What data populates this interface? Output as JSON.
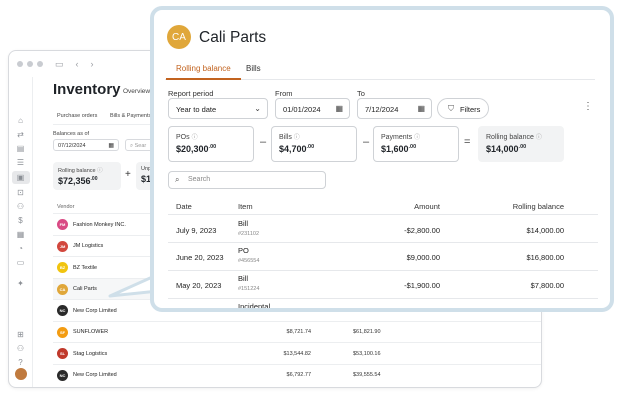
{
  "background_app": {
    "title": "Inventory",
    "overview_tab": "Overview",
    "subtabs": [
      "Purchase orders",
      "Bills & Payments"
    ],
    "balances_label": "Balances as of",
    "balances_date": "07/12/2024",
    "search_fragment": "Sear",
    "rolling_balance_label": "Rolling balance",
    "rolling_balance_value": "$72,356",
    "rolling_balance_cents": ".00",
    "plus": "+",
    "unpaid_label": "Unpa",
    "unpaid_value": "$13",
    "vendor_header": "Vendor",
    "vendors": [
      {
        "name": "Fashion Monkey INC.",
        "logo": "FM",
        "color": "#d94a84",
        "amt1": "",
        "amt2": ""
      },
      {
        "name": "JM Logistics",
        "logo": "JM",
        "color": "#d2473d",
        "amt1": "",
        "amt2": ""
      },
      {
        "name": "BZ Textile",
        "logo": "BZ",
        "color": "#f1c40f",
        "amt1": "",
        "amt2": ""
      },
      {
        "name": "Cali Parts",
        "logo": "CA",
        "color": "#e0a73a",
        "amt1": "",
        "amt2": ""
      },
      {
        "name": "New Corp Limited",
        "logo": "NC",
        "color": "#2a2a2a",
        "amt1": "",
        "amt2": ""
      },
      {
        "name": "SUNFLOWER",
        "logo": "SF",
        "color": "#f39c12",
        "amt1": "$8,721.74",
        "amt2": "$61,821.90"
      },
      {
        "name": "Stag Logistics",
        "logo": "SL",
        "color": "#c0392b",
        "amt1": "$13,544.82",
        "amt2": "$53,100.16"
      },
      {
        "name": "New Corp Limited",
        "logo": "NC",
        "color": "#2a2a2a",
        "amt1": "$6,792.77",
        "amt2": "$39,555.54"
      }
    ]
  },
  "panel": {
    "avatar_initials": "CA",
    "title": "Cali Parts",
    "tabs": [
      "Rolling balance",
      "Bills"
    ],
    "report_period_label": "Report period",
    "report_period_value": "Year to date",
    "from_label": "From",
    "from_value": "01/01/2024",
    "to_label": "To",
    "to_value": "7/12/2024",
    "filters_label": "Filters",
    "summary": [
      {
        "label": "POs",
        "value": "$20,300",
        "cents": ".00"
      },
      {
        "label": "Bills",
        "value": "$4,700",
        "cents": ".00"
      },
      {
        "label": "Payments",
        "value": "$1,600",
        "cents": ".00"
      },
      {
        "label": "Rolling balance",
        "value": "$14,000",
        "cents": ".00"
      }
    ],
    "operators": [
      "–",
      "–",
      "="
    ],
    "search_placeholder": "Search",
    "table": {
      "headers": [
        "Date",
        "Item",
        "Amount",
        "Rolling balance"
      ],
      "rows": [
        {
          "date": "July 9, 2023",
          "item": "Bill",
          "ref": "#231102",
          "amount": "-$2,800.00",
          "balance": "$14,000.00"
        },
        {
          "date": "June 20, 2023",
          "item": "PO",
          "ref": "#456554",
          "amount": "$9,000.00",
          "balance": "$16,800.00"
        },
        {
          "date": "May 20, 2023",
          "item": "Bill",
          "ref": "#151224",
          "amount": "-$1,900.00",
          "balance": "$7,800.00"
        },
        {
          "date": "",
          "item": "Incidental",
          "ref": "",
          "amount": "",
          "balance": ""
        }
      ]
    }
  },
  "colors": {
    "accent": "#c2631f",
    "panel_border": "#cfdfe9",
    "avatar": "#e0a73a"
  }
}
